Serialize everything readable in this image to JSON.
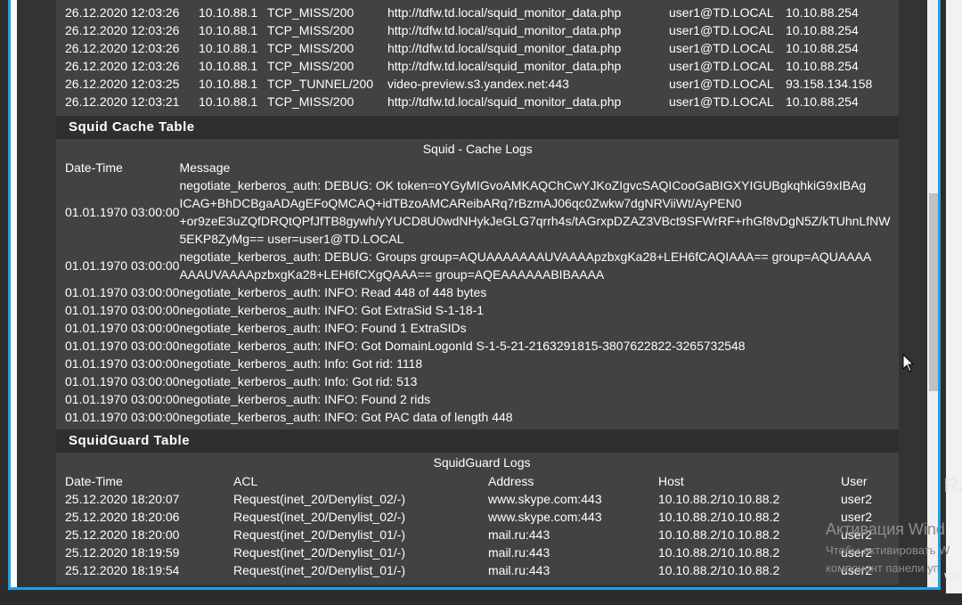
{
  "access_rows": [
    [
      "26.12.2020 12:03:26",
      "10.10.88.1",
      "TCP_MISS/200",
      "http://tdfw.td.local/squid_monitor_data.php",
      "user1@TD.LOCAL",
      "10.10.88.254"
    ],
    [
      "26.12.2020 12:03:26",
      "10.10.88.1",
      "TCP_MISS/200",
      "http://tdfw.td.local/squid_monitor_data.php",
      "user1@TD.LOCAL",
      "10.10.88.254"
    ],
    [
      "26.12.2020 12:03:26",
      "10.10.88.1",
      "TCP_MISS/200",
      "http://tdfw.td.local/squid_monitor_data.php",
      "user1@TD.LOCAL",
      "10.10.88.254"
    ],
    [
      "26.12.2020 12:03:26",
      "10.10.88.1",
      "TCP_MISS/200",
      "http://tdfw.td.local/squid_monitor_data.php",
      "user1@TD.LOCAL",
      "10.10.88.254"
    ],
    [
      "26.12.2020 12:03:25",
      "10.10.88.1",
      "TCP_TUNNEL/200",
      "video-preview.s3.yandex.net:443",
      "user1@TD.LOCAL",
      "93.158.134.158"
    ],
    [
      "26.12.2020 12:03:21",
      "10.10.88.1",
      "TCP_MISS/200",
      "http://tdfw.td.local/squid_monitor_data.php",
      "user1@TD.LOCAL",
      "10.10.88.254"
    ]
  ],
  "cache": {
    "title": "Squid Cache Table",
    "caption": "Squid - Cache Logs",
    "columns": [
      "Date-Time",
      "Message"
    ],
    "rows": [
      [
        "01.01.1970 03:00:00",
        "negotiate_kerberos_auth: DEBUG: OK token=oYGyMIGvoAMKAQChCwYJKoZIgvcSAQICooGaBIGXYIGUBgkqhkiG9xIBAg ICAG+BhDCBgaADAgEFoQMCAQ+idTBzoAMCAReibARq7rBzmAJ06qc0Zwkw7dgNRViiWt/AyPEN0 +or9zeE3uZQfDRQtQPfJfTB8gywh/yYUCD8U0wdNHykJeGLG7qrrh4s/tAGrxpDZAZ3VBct9SFWrRF+rhGf8vDgN5Z/kTUhnLfNW 5EKP8ZyMg== user=user1@TD.LOCAL"
      ],
      [
        "01.01.1970 03:00:00",
        "negotiate_kerberos_auth: DEBUG: Groups group=AQUAAAAAAAUVAAAApzbxgKa28+LEH6fCAQIAAA== group=AQUAAAA AAAUVAAAApzbxgKa28+LEH6fCXgQAAA== group=AQEAAAAAABIBAAAA"
      ],
      [
        "01.01.1970 03:00:00",
        "negotiate_kerberos_auth: INFO: Read 448 of 448 bytes"
      ],
      [
        "01.01.1970 03:00:00",
        "negotiate_kerberos_auth: INFO: Got ExtraSid S-1-18-1"
      ],
      [
        "01.01.1970 03:00:00",
        "negotiate_kerberos_auth: INFO: Found 1 ExtraSIDs"
      ],
      [
        "01.01.1970 03:00:00",
        "negotiate_kerberos_auth: INFO: Got DomainLogonId S-1-5-21-2163291815-3807622822-3265732548"
      ],
      [
        "01.01.1970 03:00:00",
        "negotiate_kerberos_auth: Info: Got rid: 1118"
      ],
      [
        "01.01.1970 03:00:00",
        "negotiate_kerberos_auth: Info: Got rid: 513"
      ],
      [
        "01.01.1970 03:00:00",
        "negotiate_kerberos_auth: INFO: Found 2 rids"
      ],
      [
        "01.01.1970 03:00:00",
        "negotiate_kerberos_auth: INFO: Got PAC data of length 448"
      ]
    ]
  },
  "guard": {
    "title": "SquidGuard Table",
    "caption": "SquidGuard Logs",
    "columns": [
      "Date-Time",
      "ACL",
      "Address",
      "Host",
      "User"
    ],
    "rows": [
      [
        "25.12.2020 18:20:07",
        "Request(inet_20/Denylist_02/-)",
        "www.skype.com:443",
        "10.10.88.2/10.10.88.2",
        "user2"
      ],
      [
        "25.12.2020 18:20:06",
        "Request(inet_20/Denylist_02/-)",
        "www.skype.com:443",
        "10.10.88.2/10.10.88.2",
        "user2"
      ],
      [
        "25.12.2020 18:20:00",
        "Request(inet_20/Denylist_01/-)",
        "mail.ru:443",
        "10.10.88.2/10.10.88.2",
        "user2"
      ],
      [
        "25.12.2020 18:19:59",
        "Request(inet_20/Denylist_01/-)",
        "mail.ru:443",
        "10.10.88.2/10.10.88.2",
        "user2"
      ],
      [
        "25.12.2020 18:19:54",
        "Request(inet_20/Denylist_01/-)",
        "mail.ru:443",
        "10.10.88.2/10.10.88.2",
        "user2"
      ]
    ]
  },
  "watermark": {
    "line1": "Активация Wind",
    "line2": "Чтобы активировать W",
    "line3": "компонент панели уп"
  },
  "edge": {
    "text1": "R2",
    "text2": "Win"
  },
  "colors": {
    "accent": "#1ea0e6",
    "panel": "#424242",
    "header": "#2f2f2f"
  }
}
